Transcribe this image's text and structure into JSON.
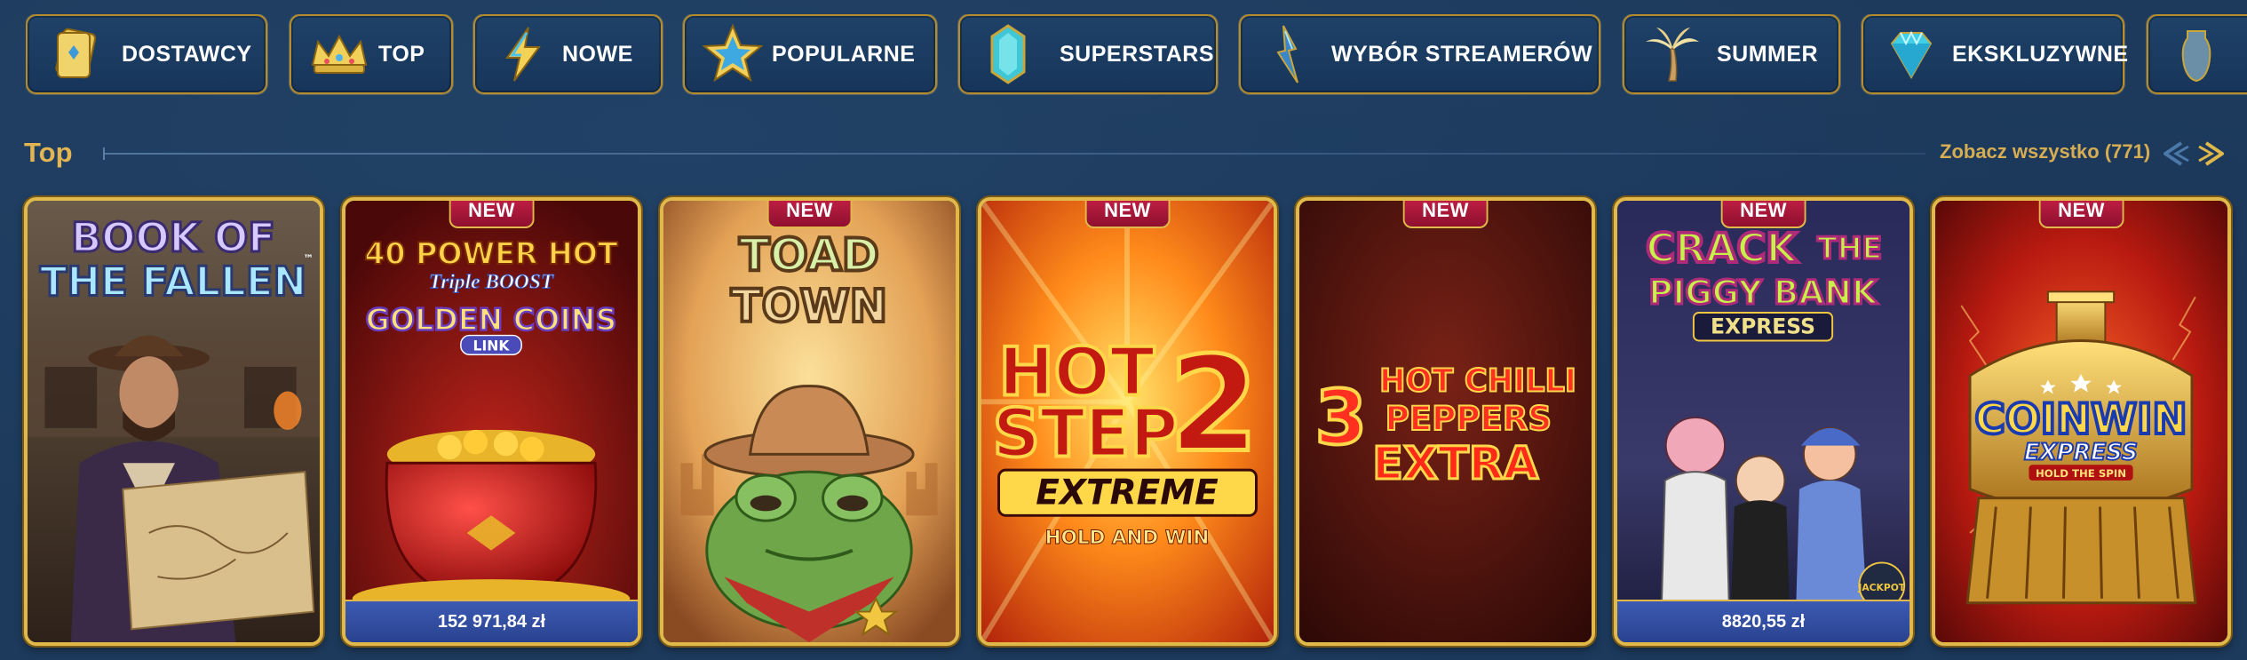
{
  "categories": [
    {
      "label": "DOSTAWCY",
      "icon": "card-deck-icon"
    },
    {
      "label": "TOP",
      "icon": "crown-icon"
    },
    {
      "label": "NOWE",
      "icon": "lightning-icon"
    },
    {
      "label": "POPULARNE",
      "icon": "star-icon"
    },
    {
      "label": "SUPERSTARS",
      "icon": "crystal-icon"
    },
    {
      "label": "WYBÓR STREAMERÓW",
      "icon": "bolt-crystal-icon"
    },
    {
      "label": "SUMMER",
      "icon": "palm-tree-icon"
    },
    {
      "label": "EKSKLUZYWNE",
      "icon": "diamond-icon"
    }
  ],
  "section": {
    "title": "Top",
    "see_all": "Zobacz wszystko (771)"
  },
  "badge_new": "NEW",
  "games": [
    {
      "title_line1": "BOOK OF",
      "title_line2": "THE FALLEN",
      "tm": "™",
      "is_new": false,
      "jackpot": ""
    },
    {
      "title_line1": "40 POWER HOT",
      "title_line2": "Triple BOOST",
      "title_line3": "GOLDEN COINS",
      "title_line4": "LINK",
      "is_new": true,
      "jackpot": "152 971,84 zł"
    },
    {
      "title_line1": "TOAD",
      "title_line2": "TOWN",
      "is_new": true,
      "jackpot": ""
    },
    {
      "title_line1": "HOT",
      "title_line2": "STEP",
      "title_num": "2",
      "title_line3": "EXTREME",
      "title_line4": "HOLD AND WIN",
      "is_new": true,
      "jackpot": ""
    },
    {
      "title_num": "3",
      "title_line1": "HOT",
      "title_line1b": "CHILLI",
      "title_line2": "PEPPERS",
      "title_line3": "EXTRA",
      "is_new": true,
      "jackpot": ""
    },
    {
      "title_line1": "CRACK",
      "title_line1b": "THE",
      "title_line2": "PIGGY BANK",
      "title_line3": "EXPRESS",
      "title_line4": "JACKPOT",
      "is_new": true,
      "jackpot": "8820,55 zł"
    },
    {
      "title_line1": "COINWIN",
      "title_line2": "EXPRESS",
      "title_line3": "HOLD THE SPIN",
      "is_new": true,
      "jackpot": ""
    }
  ]
}
